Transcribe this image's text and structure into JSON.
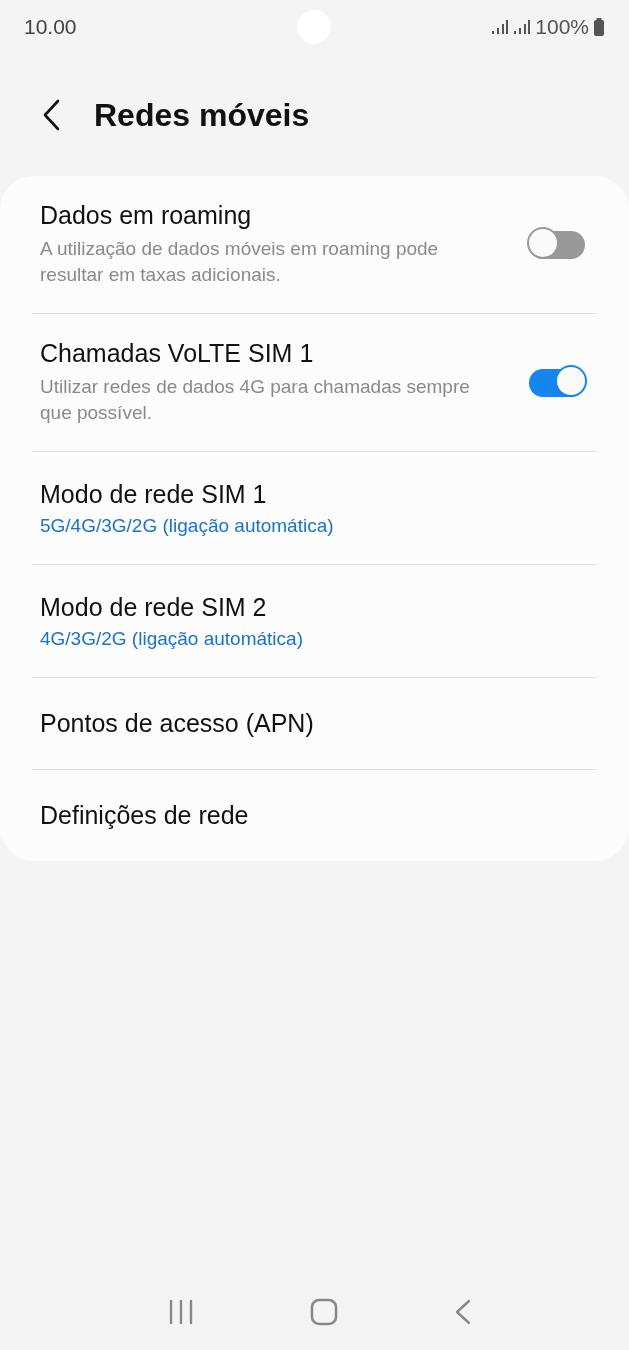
{
  "status_bar": {
    "time": "10.00",
    "battery": "100%"
  },
  "header": {
    "title": "Redes móveis"
  },
  "items": [
    {
      "kind": "toggle",
      "title": "Dados em roaming",
      "summary": "A utilização de dados móveis em roaming pode resultar em taxas adicionais.",
      "on": false
    },
    {
      "kind": "toggle",
      "title": "Chamadas VoLTE SIM 1",
      "summary": "Utilizar redes de dados 4G para chamadas sempre que possível.",
      "on": true
    },
    {
      "kind": "value",
      "title": "Modo de rede SIM 1",
      "value": "5G/4G/3G/2G (ligação automática)"
    },
    {
      "kind": "value",
      "title": "Modo de rede SIM 2",
      "value": "4G/3G/2G (ligação automática)"
    },
    {
      "kind": "plain",
      "title": "Pontos de acesso (APN)"
    },
    {
      "kind": "plain",
      "title": "Definições de rede"
    }
  ]
}
